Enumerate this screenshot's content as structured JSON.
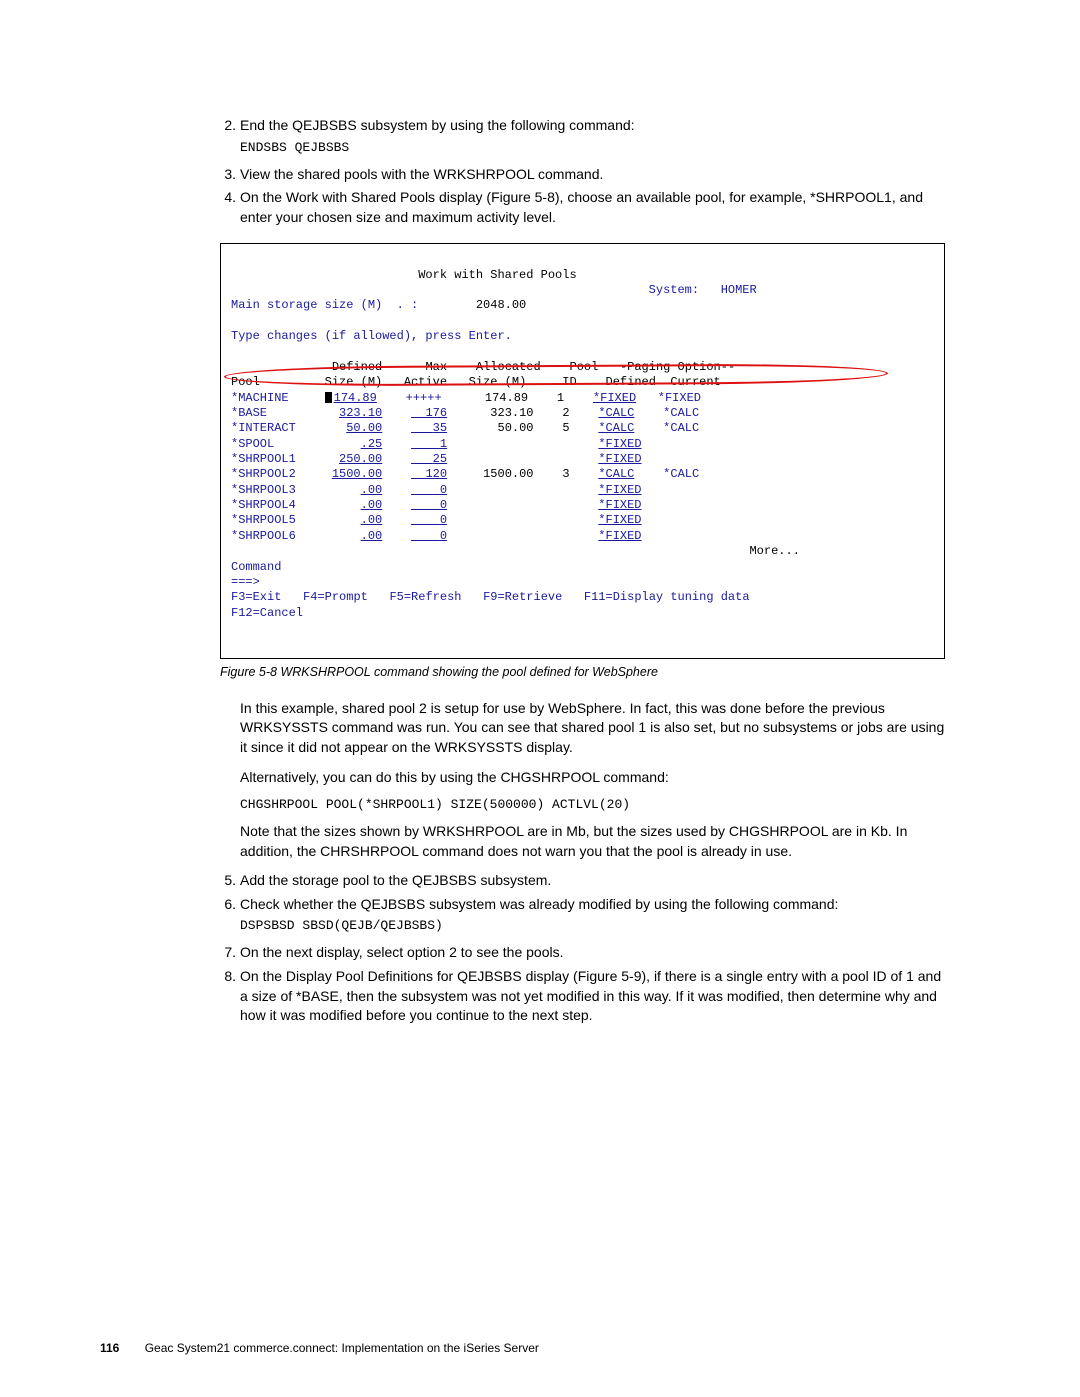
{
  "steps": {
    "s2": {
      "n": "2.",
      "t": "End the QEJBSBS subsystem by using the following command:"
    },
    "s2_code": "ENDSBS QEJBSBS",
    "s3": {
      "n": "3.",
      "t": "View the shared pools with the WRKSHRPOOL command."
    },
    "s4": {
      "n": "4.",
      "t": "On the Work with Shared Pools display (Figure 5-8), choose an available pool, for example, *SHRPOOL1, and enter your chosen size and maximum activity level."
    },
    "s5": {
      "n": "5.",
      "t": "Add the storage pool to the QEJBSBS subsystem."
    },
    "s6": {
      "n": "6.",
      "t": "Check whether the QEJBSBS subsystem was already modified by using the following command:"
    },
    "s6_code": "DSPSBSD SBSD(QEJB/QEJBSBS)",
    "s7": {
      "n": "7.",
      "t": "On the next display, select option 2 to see the pools."
    },
    "s8": {
      "n": "8.",
      "t": "On the Display Pool Definitions for QEJBSBS display (Figure 5-9), if there is a single entry with a pool ID of 1 and a size of *BASE, then the subsystem was not yet modified in this way. If it was modified, then determine why and how it was modified before you continue to the next step."
    }
  },
  "figure": {
    "title": "Work with Shared Pools",
    "sys_lbl": "System:",
    "sys_val": "HOMER",
    "storage_lbl": "Main storage size (M)  . :",
    "storage_val": "2048.00",
    "hint": "Type changes (if allowed), press Enter.",
    "hdr1a": "Defined",
    "hdr1b": "Max",
    "hdr1c": "Allocated",
    "hdr1d": "Pool",
    "hdr1e": "-Paging Option--",
    "hdr2a": "Pool",
    "hdr2b": "Size (M)",
    "hdr2c": "Active",
    "hdr2d": "Size (M)",
    "hdr2e": "ID",
    "hdr2f": "Defined",
    "hdr2g": "Current",
    "rows": {
      "r1": {
        "p": "*MACHINE",
        "size": "174.89",
        "act": "+++++",
        "alloc": "174.89",
        "id": "1",
        "pd": "*FIXED",
        "pc": "*FIXED"
      },
      "r2": {
        "p": "*BASE",
        "size": "323.10",
        "act": "176",
        "alloc": "323.10",
        "id": "2",
        "pd": "*CALC",
        "pc": "*CALC"
      },
      "r3": {
        "p": "*INTERACT",
        "size": "50.00",
        "act": "35",
        "alloc": "50.00",
        "id": "5",
        "pd": "*CALC",
        "pc": "*CALC"
      },
      "r4": {
        "p": "*SPOOL",
        "size": ".25",
        "act": "1",
        "alloc": "",
        "id": "",
        "pd": "*FIXED",
        "pc": ""
      },
      "r5": {
        "p": "*SHRPOOL1",
        "size": "250.00",
        "act": "25",
        "alloc": "",
        "id": "",
        "pd": "*FIXED",
        "pc": ""
      },
      "r6": {
        "p": "*SHRPOOL2",
        "size": "1500.00",
        "act": "120",
        "alloc": "1500.00",
        "id": "3",
        "pd": "*CALC",
        "pc": "*CALC"
      },
      "r7": {
        "p": "*SHRPOOL3",
        "size": ".00",
        "act": "0",
        "alloc": "",
        "id": "",
        "pd": "*FIXED",
        "pc": ""
      },
      "r8": {
        "p": "*SHRPOOL4",
        "size": ".00",
        "act": "0",
        "alloc": "",
        "id": "",
        "pd": "*FIXED",
        "pc": ""
      },
      "r9": {
        "p": "*SHRPOOL5",
        "size": ".00",
        "act": "0",
        "alloc": "",
        "id": "",
        "pd": "*FIXED",
        "pc": ""
      },
      "r10": {
        "p": "*SHRPOOL6",
        "size": ".00",
        "act": "0",
        "alloc": "",
        "id": "",
        "pd": "*FIXED",
        "pc": ""
      }
    },
    "more": "More...",
    "cmd_lbl": "Command",
    "prompt": "===>",
    "fkeys": {
      "f3": "F3=Exit",
      "f4": "F4=Prompt",
      "f5": "F5=Refresh",
      "f9": "F9=Retrieve",
      "f11": "F11=Display tuning data",
      "f12": "F12=Cancel"
    }
  },
  "caption": "Figure 5-8   WRKSHRPOOL command showing the pool defined for WebSphere",
  "paras": {
    "p1": "In this example, shared pool 2 is setup for use by WebSphere. In fact, this was done before the previous WRKSYSSTS command was run. You can see that shared pool 1 is also set, but no subsystems or jobs are using it since it did not appear on the WRKSYSSTS display.",
    "p2": "Alternatively, you can do this by using the CHGSHRPOOL command:",
    "p2_code": "CHGSHRPOOL POOL(*SHRPOOL1) SIZE(500000) ACTLVL(20)",
    "p3": "Note that the sizes shown by WRKSHRPOOL are in Mb, but the sizes used by CHGSHRPOOL are in Kb. In addition, the CHRSHRPOOL command does not warn you that the pool is already in use."
  },
  "footer": {
    "page": "116",
    "title": "Geac System21 commerce.connect: Implementation on the iSeries Server"
  }
}
